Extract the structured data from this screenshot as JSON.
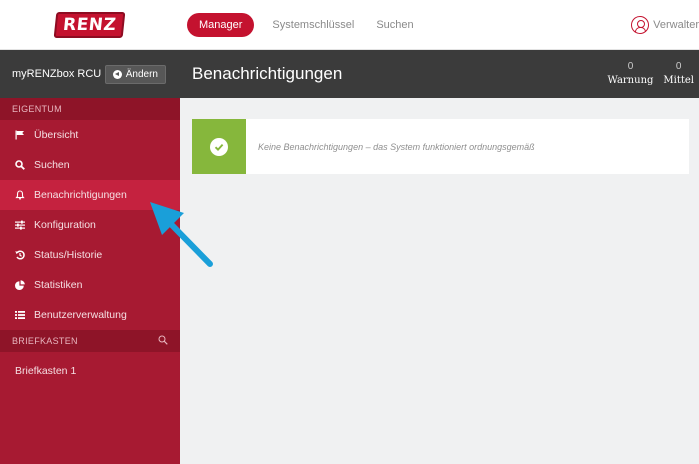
{
  "header": {
    "logo_text": "RENZ",
    "nav": [
      {
        "label": "Manager",
        "active": true
      },
      {
        "label": "Systemschlüssel",
        "active": false
      },
      {
        "label": "Suchen",
        "active": false
      }
    ],
    "user_label": "Verwalter",
    "user_icon": "user-circle-icon"
  },
  "sidebar": {
    "box_name": "myRENZbox RCU",
    "change_button": "Ändern",
    "section_property": "EIGENTUM",
    "items": [
      {
        "label": "Übersicht",
        "icon": "flag-icon"
      },
      {
        "label": "Suchen",
        "icon": "search-icon"
      },
      {
        "label": "Benachrichtigungen",
        "icon": "bell-icon",
        "active": true
      },
      {
        "label": "Konfiguration",
        "icon": "sliders-icon"
      },
      {
        "label": "Status/Historie",
        "icon": "history-icon"
      },
      {
        "label": "Statistiken",
        "icon": "pie-chart-icon"
      },
      {
        "label": "Benutzerverwaltung",
        "icon": "list-icon"
      }
    ],
    "section_mailbox": "BRIEFKASTEN",
    "mailboxes": [
      "Briefkasten 1"
    ]
  },
  "main": {
    "title": "Benachrichtigungen",
    "counters": [
      {
        "value": "0",
        "label": "Warnung"
      },
      {
        "value": "0",
        "label": "Mittel"
      }
    ],
    "notice_text": "Keine Benachrichtigungen – das System funktioniert ordnungsgemäß"
  },
  "colors": {
    "brand": "#c4122f",
    "sidebar": "#a71a32",
    "header_dark": "#3b3b3b",
    "success": "#86b73c",
    "arrow": "#1a9fd9"
  }
}
